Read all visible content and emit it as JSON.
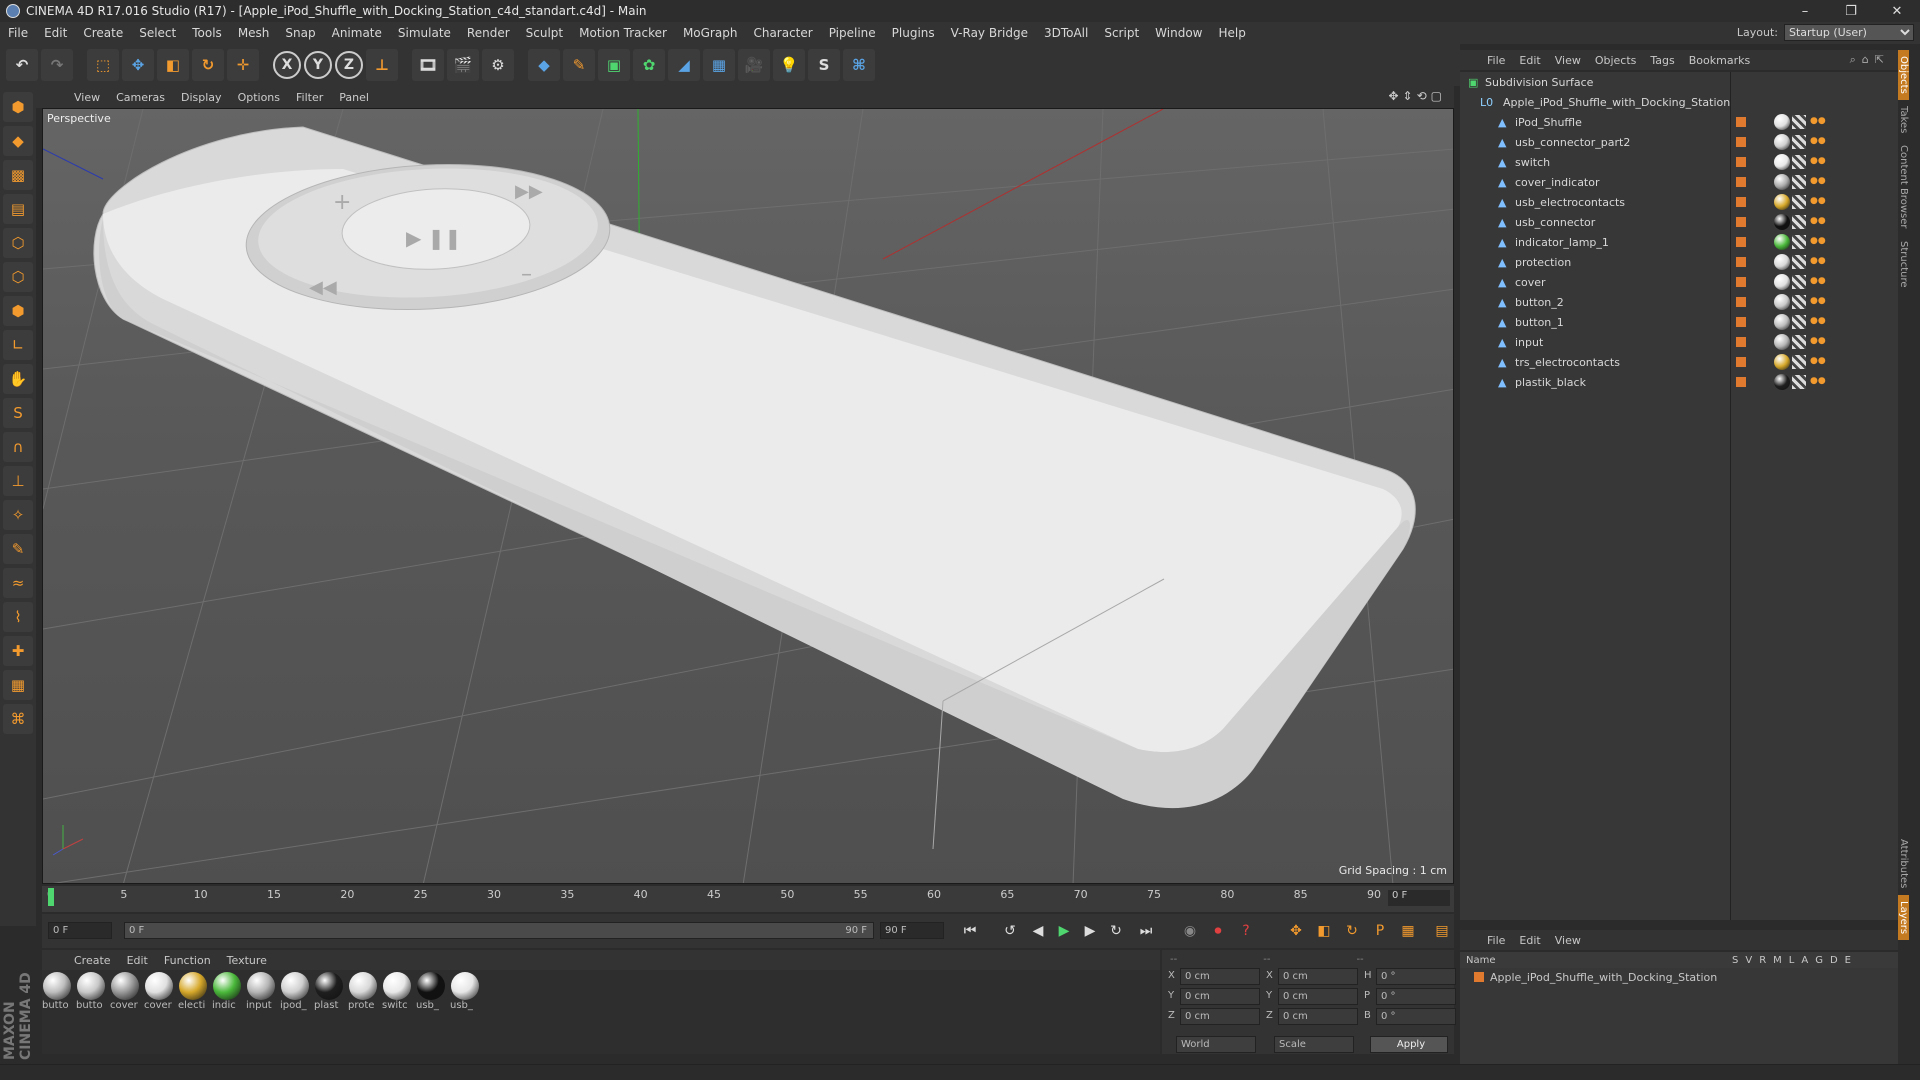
{
  "window": {
    "title": "CINEMA 4D R17.016 Studio (R17) - [Apple_iPod_Shuffle_with_Docking_Station_c4d_standart.c4d] - Main",
    "controls": [
      "–",
      "❐",
      "✕"
    ]
  },
  "menubar": {
    "items": [
      "File",
      "Edit",
      "Create",
      "Select",
      "Tools",
      "Mesh",
      "Snap",
      "Animate",
      "Simulate",
      "Render",
      "Sculpt",
      "Motion Tracker",
      "MoGraph",
      "Character",
      "Pipeline",
      "Plugins",
      "V-Ray Bridge",
      "3DToAll",
      "Script",
      "Window",
      "Help"
    ],
    "layout_label": "Layout:",
    "layout_value": "Startup (User)"
  },
  "toolbar": {
    "icons": [
      "undo-icon",
      "redo-icon",
      "live-selection-icon",
      "move-icon",
      "scale-icon",
      "rotate-icon",
      "recent-tool-icon",
      "x-axis-icon",
      "y-axis-icon",
      "z-axis-icon",
      "world-coordinates-icon",
      "render-view-icon",
      "render-to-picture-viewer-icon",
      "edit-render-settings-icon",
      "cube-icon",
      "pen-icon",
      "subdivision-icon",
      "cloner-icon",
      "deformer-icon",
      "floor-icon",
      "camera-icon",
      "light-icon",
      "s-icon",
      "python-icon"
    ],
    "axis_labels": [
      "X",
      "Y",
      "Z"
    ]
  },
  "viewport": {
    "menu": [
      "View",
      "Cameras",
      "Display",
      "Options",
      "Filter",
      "Panel"
    ],
    "camera_label": "Perspective",
    "grid_spacing": "Grid Spacing : 1 cm"
  },
  "timeline": {
    "ticks": [
      "0",
      "5",
      "10",
      "15",
      "20",
      "25",
      "30",
      "35",
      "40",
      "45",
      "50",
      "55",
      "60",
      "65",
      "70",
      "75",
      "80",
      "85",
      "90"
    ],
    "current_frame": "0 F",
    "start_field": "0 F",
    "range_start": "0 F",
    "range_end": "90 F",
    "end_field": "90 F"
  },
  "materials": {
    "menu": [
      "Create",
      "Edit",
      "Function",
      "Texture"
    ],
    "items": [
      {
        "label": "butto",
        "color": "#bdbdbd"
      },
      {
        "label": "butto",
        "color": "#c8c8c8"
      },
      {
        "label": "cover",
        "color": "#9a9a9a"
      },
      {
        "label": "cover",
        "color": "#e0e0e0"
      },
      {
        "label": "electi",
        "color": "#d6a82a"
      },
      {
        "label": "indic",
        "color": "#4ab83a"
      },
      {
        "label": "input",
        "color": "#b5b5b5"
      },
      {
        "label": "ipod_",
        "color": "#cfcfcf"
      },
      {
        "label": "plast",
        "color": "#1e1e1e"
      },
      {
        "label": "prote",
        "color": "#d8d8d8"
      },
      {
        "label": "switc",
        "color": "#e8e8e8"
      },
      {
        "label": "usb_",
        "color": "#111111"
      },
      {
        "label": "usb_",
        "color": "#e6e6e6"
      }
    ]
  },
  "coordinates": {
    "header": [
      "--",
      "--",
      "--"
    ],
    "rows": [
      {
        "a": "X",
        "av": "0 cm",
        "b": "X",
        "bv": "0 cm",
        "c": "H",
        "cv": "0 °"
      },
      {
        "a": "Y",
        "av": "0 cm",
        "b": "Y",
        "bv": "0 cm",
        "c": "P",
        "cv": "0 °"
      },
      {
        "a": "Z",
        "av": "0 cm",
        "b": "Z",
        "bv": "0 cm",
        "c": "B",
        "cv": "0 °"
      }
    ],
    "mode": "World",
    "scale": "Scale",
    "apply": "Apply"
  },
  "objects": {
    "menu": [
      "File",
      "Edit",
      "View",
      "Objects",
      "Tags",
      "Bookmarks"
    ],
    "tree": [
      {
        "name": "Subdivision Surface",
        "level": 0,
        "tag_color": ""
      },
      {
        "name": "Apple_iPod_Shuffle_with_Docking_Station",
        "level": 1,
        "tag_color": ""
      },
      {
        "name": "iPod_Shuffle",
        "level": 2,
        "tag_color": "#e0e0e0"
      },
      {
        "name": "usb_connector_part2",
        "level": 2,
        "tag_color": "#d0d0d0"
      },
      {
        "name": "switch",
        "level": 2,
        "tag_color": "#e8e8e8"
      },
      {
        "name": "cover_indicator",
        "level": 2,
        "tag_color": "#aaaaaa"
      },
      {
        "name": "usb_electrocontacts",
        "level": 2,
        "tag_color": "#d6a82a"
      },
      {
        "name": "usb_connector",
        "level": 2,
        "tag_color": "#111111"
      },
      {
        "name": "indicator_lamp_1",
        "level": 2,
        "tag_color": "#4ab83a"
      },
      {
        "name": "protection",
        "level": 2,
        "tag_color": "#d8d8d8"
      },
      {
        "name": "cover",
        "level": 2,
        "tag_color": "#e0e0e0"
      },
      {
        "name": "button_2",
        "level": 2,
        "tag_color": "#c8c8c8"
      },
      {
        "name": "button_1",
        "level": 2,
        "tag_color": "#bdbdbd"
      },
      {
        "name": "input",
        "level": 2,
        "tag_color": "#b5b5b5"
      },
      {
        "name": "trs_electrocontacts",
        "level": 2,
        "tag_color": "#d6a82a"
      },
      {
        "name": "plastik_black",
        "level": 2,
        "tag_color": "#1e1e1e"
      }
    ]
  },
  "side_tabs": [
    "Objects",
    "Takes",
    "Content Browser",
    "Structure",
    "Attributes",
    "Layers"
  ],
  "layers": {
    "menu": [
      "File",
      "Edit",
      "View"
    ],
    "header_name": "Name",
    "header_cols": [
      "S",
      "V",
      "R",
      "M",
      "L",
      "A",
      "G",
      "D",
      "E"
    ],
    "row_name": "Apple_iPod_Shuffle_with_Docking_Station"
  },
  "branding": {
    "logo": "MAXON CINEMA 4D"
  }
}
